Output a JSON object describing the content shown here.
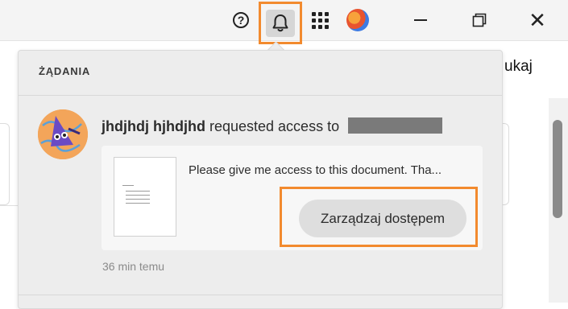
{
  "titlebar": {
    "help_icon": "question-circle",
    "help_glyph": "?",
    "notifications_icon": "bell",
    "apps_icon": "app-grid",
    "profile_icon": "avatar",
    "minimize_icon": "minimize",
    "maximize_icon": "restore",
    "close_icon": "close",
    "close_glyph": "✕"
  },
  "background": {
    "partial_text": "ukaj"
  },
  "notifications": {
    "title": "ŻĄDANIA",
    "request": {
      "user_name": "jhdjhdj hjhdjhd",
      "action_text": "requested access to",
      "message": "Please give me access to this document. Tha...",
      "manage_button": "Zarządzaj dostępem",
      "time": "36 min temu"
    }
  },
  "colors": {
    "highlight": "#f28a2e",
    "popover_bg": "#ededed",
    "card_bg": "#f7f7f7",
    "button_bg": "#dedede"
  }
}
